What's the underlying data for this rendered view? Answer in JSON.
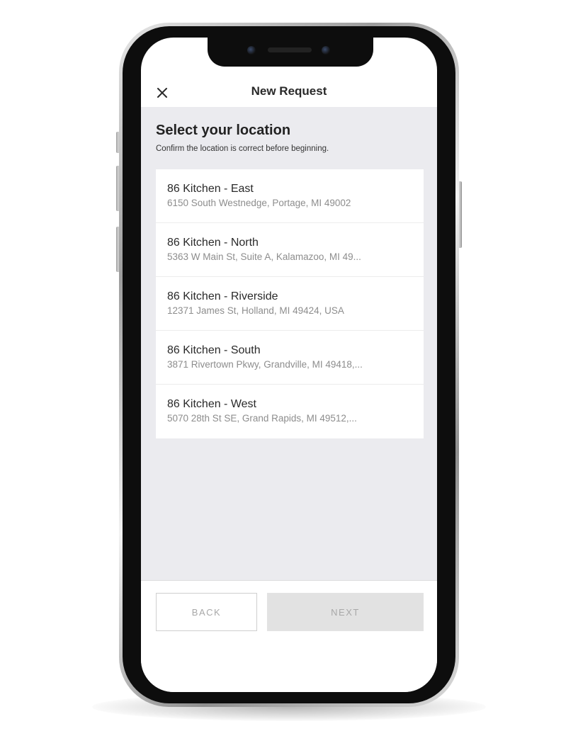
{
  "header": {
    "title": "New Request",
    "close_icon": "close-icon"
  },
  "main": {
    "title": "Select your location",
    "subtitle": "Confirm the location is correct before beginning.",
    "locations": [
      {
        "name": "86 Kitchen - East",
        "address": "6150 South Westnedge, Portage, MI 49002"
      },
      {
        "name": "86 Kitchen - North",
        "address": "5363 W Main St, Suite A, Kalamazoo, MI 49..."
      },
      {
        "name": "86 Kitchen - Riverside",
        "address": "12371 James St, Holland, MI 49424, USA"
      },
      {
        "name": "86 Kitchen - South",
        "address": "3871 Rivertown Pkwy, Grandville, MI 49418,..."
      },
      {
        "name": "86 Kitchen - West",
        "address": "5070 28th St SE, Grand Rapids, MI 49512,..."
      }
    ]
  },
  "footer": {
    "back_label": "BACK",
    "next_label": "NEXT"
  },
  "colors": {
    "content_background": "#ebebef",
    "button_text_disabled": "#a8a8a8",
    "next_button_background": "#e2e2e2"
  }
}
